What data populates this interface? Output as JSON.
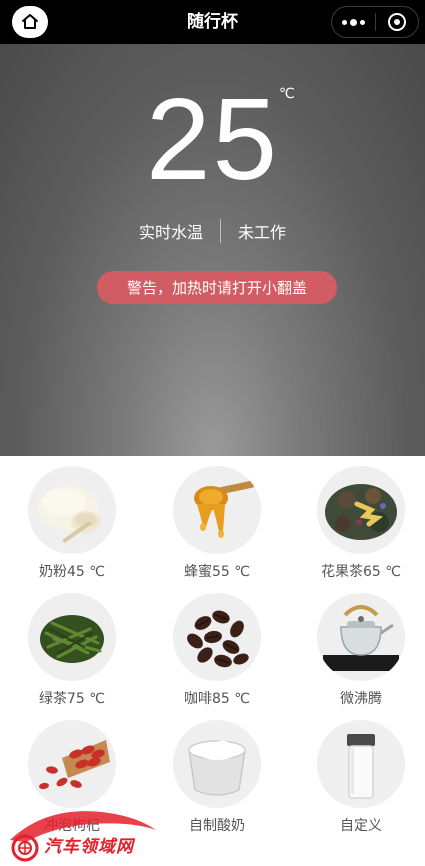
{
  "nav": {
    "title": "随行杯",
    "home_icon": "home-icon",
    "more_icon": "more-dots-icon",
    "close_icon": "target-close-icon"
  },
  "hero": {
    "temperature": "25",
    "unit": "℃",
    "status_left": "实时水温",
    "status_right": "未工作",
    "warning": "警告，加热时请打开小翻盖",
    "warning_color": "#d25c63"
  },
  "drinks": [
    {
      "label": "奶粉45 ℃",
      "icon": "milk-powder-icon"
    },
    {
      "label": "蜂蜜55 ℃",
      "icon": "honey-icon"
    },
    {
      "label": "花果茶65 ℃",
      "icon": "flower-tea-icon"
    },
    {
      "label": "绿茶75 ℃",
      "icon": "green-tea-icon"
    },
    {
      "label": "咖啡85 ℃",
      "icon": "coffee-beans-icon"
    },
    {
      "label": "微沸腾",
      "icon": "teapot-boiling-icon"
    },
    {
      "label": "冲泡枸杞",
      "icon": "goji-berry-icon"
    },
    {
      "label": "自制酸奶",
      "icon": "yogurt-icon"
    },
    {
      "label": "自定义",
      "icon": "cup-custom-icon"
    }
  ],
  "watermark": {
    "text": "汽车领域网",
    "color": "#e4202b"
  }
}
